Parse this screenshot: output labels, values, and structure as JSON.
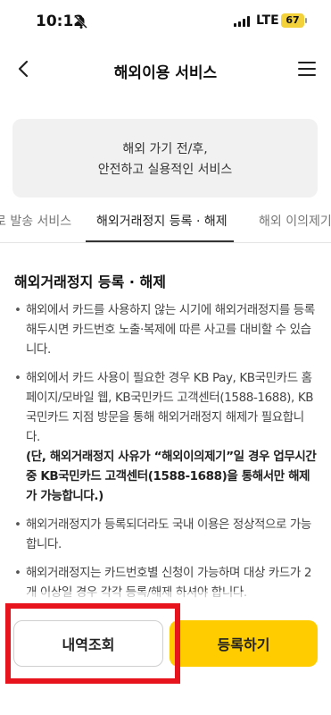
{
  "status_bar": {
    "time": "10:12",
    "network": "LTE",
    "battery": "67",
    "icons": [
      "mute-icon",
      "signal-icon",
      "battery-icon"
    ]
  },
  "header": {
    "title": "해외이용 서비스",
    "icons": [
      "back-arrow-icon",
      "hamburger-menu-icon"
    ]
  },
  "banner": {
    "line1": "해외 가기 전/후,",
    "line2": "안전하고 실용적인 서비스"
  },
  "tabs": [
    {
      "label": "로 발송 서비스"
    },
    {
      "label": "해외거래정지 등록 · 해제"
    },
    {
      "label": "해외 이의제기"
    }
  ],
  "active_tab": 1,
  "content": {
    "title": "해외거래정지 등록 · 해제",
    "bullets": [
      {
        "text": "해외에서 카드를 사용하지 않는 시기에 해외거래정지를 등록해두시면 카드번호 노출·복제에 따른 사고를 대비할 수 있습니다."
      },
      {
        "text": "해외에서 카드 사용이 필요한 경우 KB Pay, KB국민카드 홈페이지/모바일 웹, KB국민카드 고객센터(1588-1688), KB국민카드 지점 방문을 통해 해외거래정지 해제가 필요합니다.",
        "bold": "(단, 해외거래정지 사유가 “해외이의제기”일 경우 업무시간 중 KB국민카드 고객센터(1588-1688)을 통해서만 해제가 가능합니다.)"
      },
      {
        "text": "해외거래정지가 등록되더라도 국내 이용은 정상적으로 가능합니다."
      },
      {
        "text": "해외거래정지는 카드번호별 신청이 가능하며 대상 카드가 2개 이상일 경우 각각 등록/해제 하셔야 합니다."
      }
    ]
  },
  "buttons": {
    "history": "내역조회",
    "register": "등록하기"
  },
  "colors": {
    "accent": "#ffcc00",
    "highlight_frame": "#e8141d",
    "banner_bg": "#f1f1f2"
  }
}
